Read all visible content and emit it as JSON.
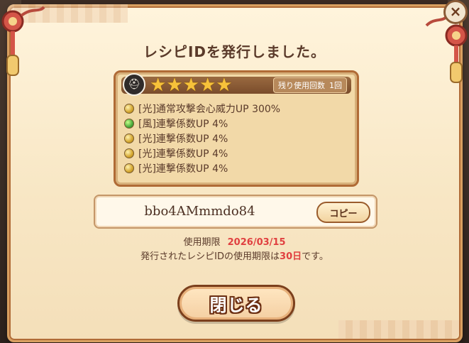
{
  "dialog": {
    "title": "レシピIDを発行しました。",
    "close_icon": "×"
  },
  "recipe": {
    "helmet_icon": "helmet-icon",
    "stars": [
      "★",
      "★",
      "★",
      "★",
      "★"
    ],
    "remaining_label": "残り使用回数",
    "remaining_value": "1回",
    "stats": [
      {
        "dot": "gold",
        "text": "[光]通常攻撃会心威力UP 300%"
      },
      {
        "dot": "green",
        "text": "[風]連撃係数UP 4%"
      },
      {
        "dot": "gold",
        "text": "[光]連撃係数UP 4%"
      },
      {
        "dot": "gold",
        "text": "[光]連撃係数UP 4%"
      },
      {
        "dot": "gold",
        "text": "[光]連撃係数UP 4%"
      }
    ]
  },
  "code": {
    "value": "bbo4AMmmdo84",
    "copy_label": "コピー"
  },
  "expiry": {
    "label": "使用期限",
    "date": "2026/03/15",
    "note_prefix": "発行されたレシピIDの使用期限は",
    "note_days": "30日",
    "note_suffix": "です。"
  },
  "buttons": {
    "close_label": "閉じる"
  },
  "colors": {
    "accent_red": "#e04040",
    "star_gold": "#f7c23a",
    "frame_brown": "#b06b36"
  }
}
